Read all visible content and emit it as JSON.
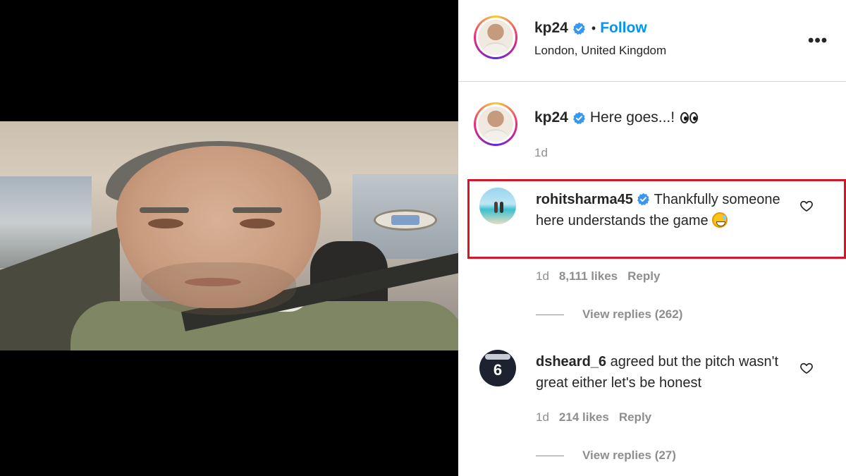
{
  "post": {
    "author": "kp24",
    "follow_label": "Follow",
    "separator": "•",
    "location": "London, United Kingdom",
    "more_icon": "more-icon",
    "caption_text": "Here goes...!",
    "caption_time": "1d"
  },
  "comments": [
    {
      "username": "rohitsharma45",
      "verified": true,
      "text": "Thankfully someone here understands the game",
      "time": "1d",
      "likes": "8,111 likes",
      "reply_label": "Reply",
      "view_replies": "View replies (262)",
      "highlighted": true
    },
    {
      "username": "dsheard_6",
      "verified": false,
      "text": "agreed but the pitch wasn't great either let's be honest",
      "time": "1d",
      "likes": "214 likes",
      "reply_label": "Reply",
      "view_replies": "View replies (27)",
      "avatar_number": "6"
    }
  ],
  "colors": {
    "accent": "#0095f6",
    "verified": "#3897f0",
    "highlight_border": "#d4152a",
    "muted_text": "#8e8e8e"
  }
}
